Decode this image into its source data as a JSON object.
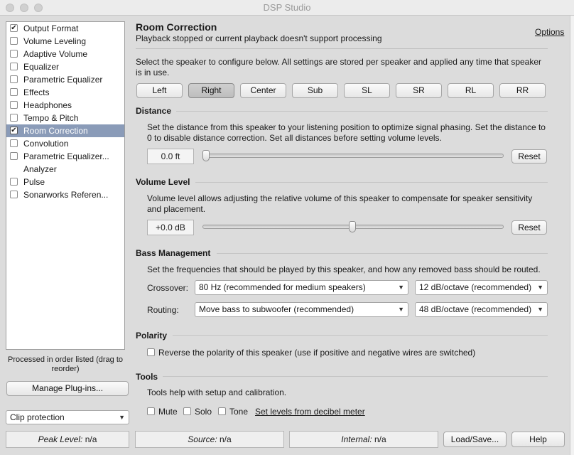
{
  "window": {
    "title": "DSP Studio"
  },
  "plugins": [
    {
      "label": "Output Format",
      "checked": true,
      "has_checkbox": true,
      "selected": false
    },
    {
      "label": "Volume Leveling",
      "checked": false,
      "has_checkbox": true,
      "selected": false
    },
    {
      "label": "Adaptive Volume",
      "checked": false,
      "has_checkbox": true,
      "selected": false
    },
    {
      "label": "Equalizer",
      "checked": false,
      "has_checkbox": true,
      "selected": false
    },
    {
      "label": "Parametric Equalizer",
      "checked": false,
      "has_checkbox": true,
      "selected": false
    },
    {
      "label": "Effects",
      "checked": false,
      "has_checkbox": true,
      "selected": false
    },
    {
      "label": "Headphones",
      "checked": false,
      "has_checkbox": true,
      "selected": false
    },
    {
      "label": "Tempo & Pitch",
      "checked": false,
      "has_checkbox": true,
      "selected": false
    },
    {
      "label": "Room Correction",
      "checked": true,
      "has_checkbox": true,
      "selected": true
    },
    {
      "label": "Convolution",
      "checked": false,
      "has_checkbox": true,
      "selected": false
    },
    {
      "label": "Parametric Equalizer...",
      "checked": false,
      "has_checkbox": true,
      "selected": false
    },
    {
      "label": "Analyzer",
      "checked": false,
      "has_checkbox": false,
      "selected": false
    },
    {
      "label": "Pulse",
      "checked": false,
      "has_checkbox": true,
      "selected": false
    },
    {
      "label": "Sonarworks Referen...",
      "checked": false,
      "has_checkbox": true,
      "selected": false
    }
  ],
  "sidebar": {
    "order_note": "Processed in order listed (drag to reorder)",
    "manage_button": "Manage Plug-ins...",
    "clip_select": "Clip protection"
  },
  "panel": {
    "title": "Room Correction",
    "subtitle": "Playback stopped or current playback doesn't support processing",
    "options_link": "Options",
    "intro": "Select the speaker to configure below.  All settings are stored per speaker and applied any time that speaker is in use.",
    "speakers": [
      "Left",
      "Right",
      "Center",
      "Sub",
      "SL",
      "SR",
      "RL",
      "RR"
    ],
    "selected_speaker": "Right"
  },
  "distance": {
    "title": "Distance",
    "description": "Set the distance from this speaker to your listening position to optimize signal phasing.  Set the distance to 0 to disable distance correction.  Set all distances before setting volume levels.",
    "value": "0.0 ft",
    "slider_position": 0.0,
    "reset": "Reset"
  },
  "volume": {
    "title": "Volume Level",
    "description": "Volume level allows adjusting the relative volume of this speaker to compensate for speaker sensitivity and placement.",
    "value": "+0.0 dB",
    "slider_position": 0.5,
    "reset": "Reset"
  },
  "bass": {
    "title": "Bass Management",
    "description": "Set the frequencies that should be played by this speaker, and how any removed bass should be routed.",
    "crossover_label": "Crossover:",
    "crossover_value": "80 Hz (recommended for medium speakers)",
    "crossover_slope": "12 dB/octave (recommended)",
    "routing_label": "Routing:",
    "routing_value": "Move bass to subwoofer (recommended)",
    "routing_slope": "48 dB/octave (recommended)"
  },
  "polarity": {
    "title": "Polarity",
    "reverse_label": "Reverse the polarity of this speaker (use if positive and negative wires are switched)"
  },
  "tools": {
    "title": "Tools",
    "description": "Tools help with setup and calibration.",
    "mute": "Mute",
    "solo": "Solo",
    "tone": "Tone",
    "meter_link": "Set levels from decibel meter"
  },
  "status": {
    "peak_label": "Peak Level:",
    "peak_value": "n/a",
    "source_label": "Source:",
    "source_value": "n/a",
    "internal_label": "Internal:",
    "internal_value": "n/a",
    "load_save": "Load/Save...",
    "help": "Help"
  }
}
